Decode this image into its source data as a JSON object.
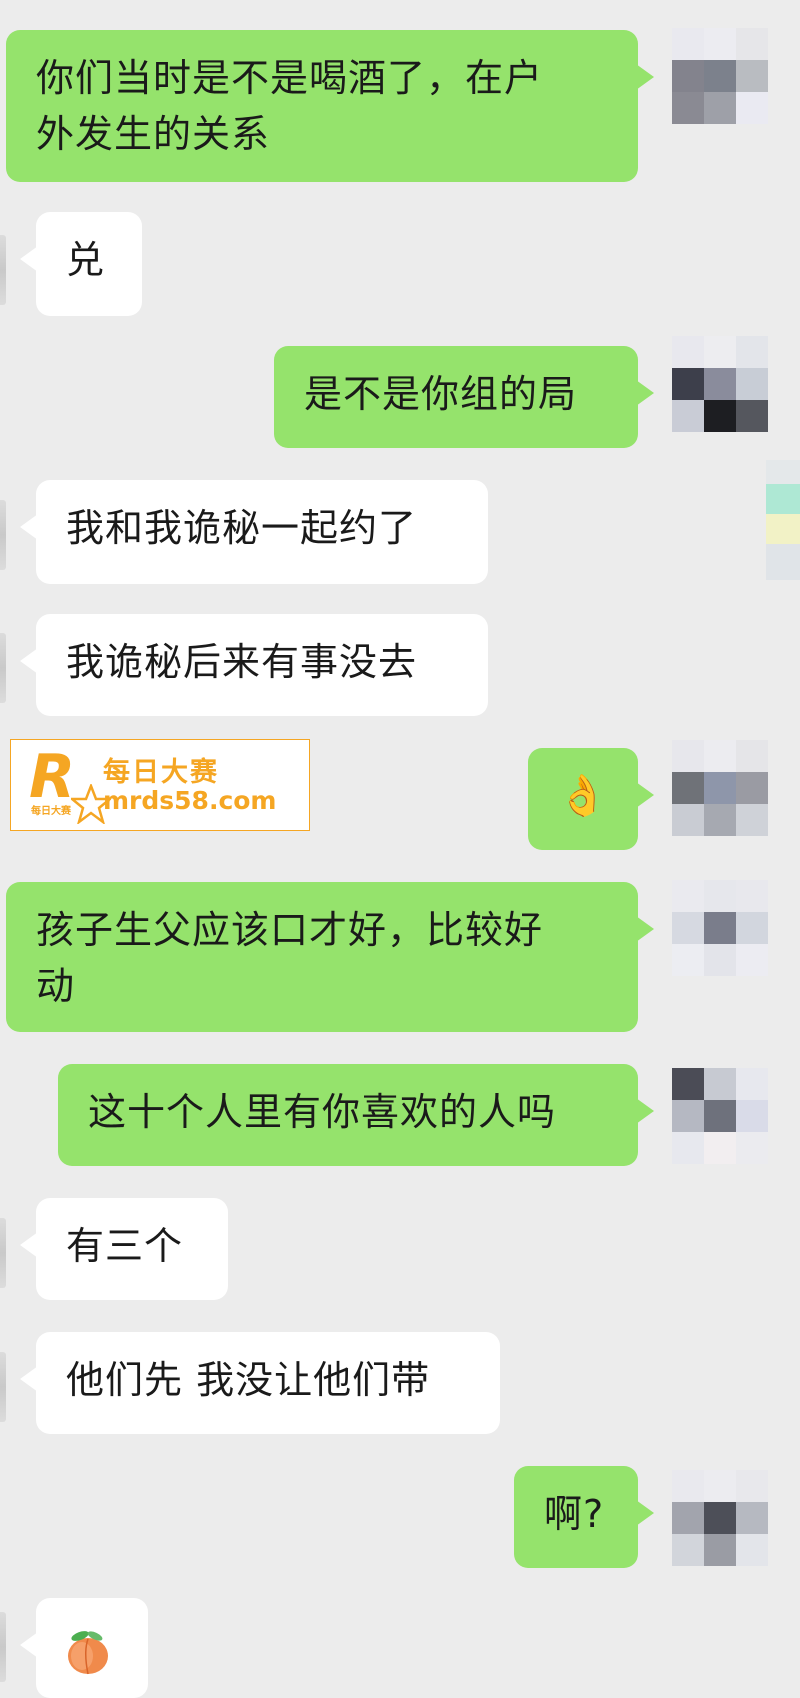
{
  "messages": [
    {
      "side": "out",
      "text_line1": "你们当时是不是喝酒了，在户",
      "text_line2": "外发生的关系"
    },
    {
      "side": "in",
      "text": "兑"
    },
    {
      "side": "out",
      "text": "是不是你组的局"
    },
    {
      "side": "in",
      "text": "我和我诡秘一起约了"
    },
    {
      "side": "in",
      "text": "我诡秘后来有事没去"
    },
    {
      "side": "out",
      "text": "👌",
      "icon": "ok-hand-emoji"
    },
    {
      "side": "out",
      "text_line1": "孩子生父应该口才好，比较好",
      "text_line2": "动"
    },
    {
      "side": "out",
      "text": "这十个人里有你喜欢的人吗"
    },
    {
      "side": "in",
      "text": "有三个"
    },
    {
      "side": "in",
      "text": "他们先 我没让他们带"
    },
    {
      "side": "out",
      "text": "啊?"
    },
    {
      "side": "in",
      "text": "",
      "icon": "peach-emoji"
    }
  ],
  "watermark": {
    "title": "每日大赛",
    "url": "mrds58.com",
    "logo_letter": "R",
    "logo_small": "每日大赛",
    "color": "#f5a623"
  },
  "colors": {
    "background": "#ececec",
    "outgoing_bubble": "#95e36c",
    "incoming_bubble": "#ffffff"
  }
}
